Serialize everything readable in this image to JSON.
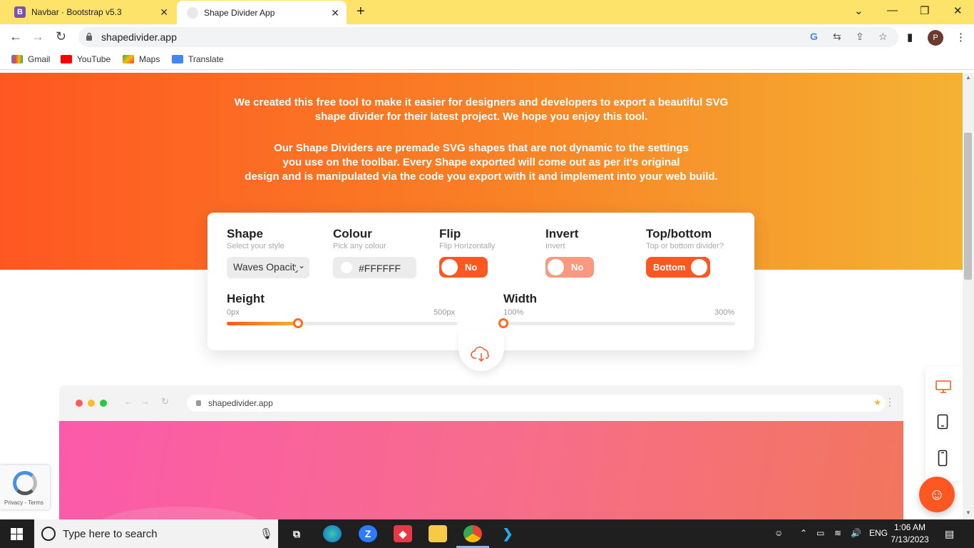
{
  "browser": {
    "tabs": [
      {
        "title": "Navbar · Bootstrap v5.3",
        "favicon": "B"
      },
      {
        "title": "Shape Divider App",
        "favicon": ""
      }
    ],
    "url": "shapedivider.app",
    "profile_initial": "P",
    "bookmarks": [
      "Gmail",
      "YouTube",
      "Maps",
      "Translate"
    ]
  },
  "hero": {
    "paragraph1_line1": "We created this free tool to make it easier for designers and developers to export a beautiful SVG",
    "paragraph1_line2": "shape divider for their latest project. We hope you enjoy this tool.",
    "paragraph2_line1": "Our Shape Dividers are premade SVG shapes that are not dynamic to the settings",
    "paragraph2_line2": "you use on the toolbar. Every Shape exported will come out as per it's original",
    "paragraph2_line3": "design and is manipulated via the code you export with it and implement into your web build."
  },
  "toolbar": {
    "shape": {
      "label": "Shape",
      "sub": "Select your style",
      "value": "Waves Opacity"
    },
    "colour": {
      "label": "Colour",
      "sub": "Pick any colour",
      "value": "#FFFFFF"
    },
    "flip": {
      "label": "Flip",
      "sub": "Flip Horizontally",
      "value": "No"
    },
    "invert": {
      "label": "Invert",
      "sub": "Invert",
      "value": "No"
    },
    "topbottom": {
      "label": "Top/bottom",
      "sub": "Top or bottom divider?",
      "value": "Bottom"
    },
    "height": {
      "label": "Height",
      "min": "0px",
      "max": "500px",
      "level": 0.31
    },
    "width": {
      "label": "Width",
      "min": "100%",
      "max": "300%",
      "level": 0.0
    }
  },
  "preview": {
    "url": "shapedivider.app"
  },
  "recaptcha": {
    "links": "Privacy - Terms"
  },
  "taskbar": {
    "search_placeholder": "Type here to search",
    "lang": "ENG",
    "time": "1:06 AM",
    "date": "7/13/2023"
  },
  "colors": {
    "accent": "#ff5722",
    "hero_start": "#ff5722",
    "hero_end": "#f4b233"
  }
}
